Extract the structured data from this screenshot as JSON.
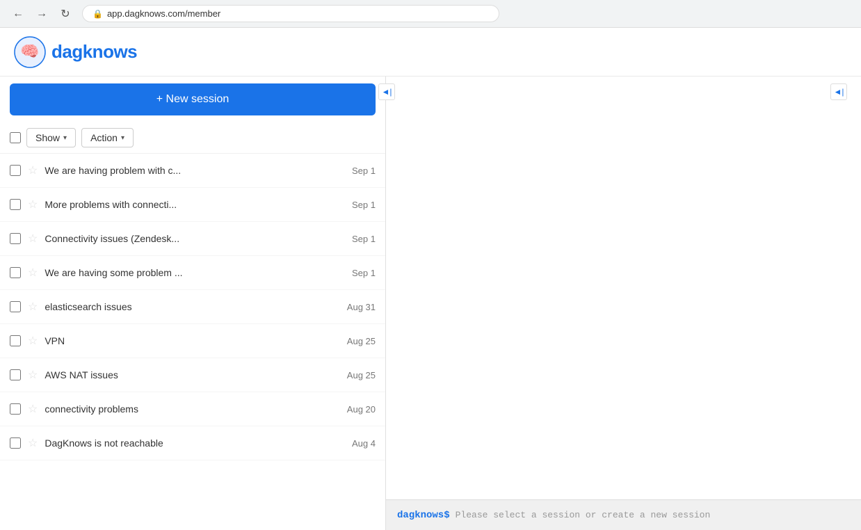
{
  "browser": {
    "url": "app.dagknows.com/member",
    "lock_icon": "🔒"
  },
  "header": {
    "logo_text": "dagknows",
    "logo_alt": "DagKnows Logo"
  },
  "left_panel": {
    "new_session_label": "+ New session",
    "show_label": "Show",
    "action_label": "Action",
    "collapse_icon": "◄|"
  },
  "right_panel": {
    "collapse_icon": "◄|"
  },
  "sessions": [
    {
      "title": "We are having problem with c...",
      "date": "Sep 1"
    },
    {
      "title": "More problems with connecti...",
      "date": "Sep 1"
    },
    {
      "title": "Connectivity issues (Zendesk...",
      "date": "Sep 1"
    },
    {
      "title": "We are having some problem ...",
      "date": "Sep 1"
    },
    {
      "title": "elasticsearch issues",
      "date": "Aug 31"
    },
    {
      "title": "VPN",
      "date": "Aug 25"
    },
    {
      "title": "AWS NAT issues",
      "date": "Aug 25"
    },
    {
      "title": "connectivity problems",
      "date": "Aug 20"
    },
    {
      "title": "DagKnows is not reachable",
      "date": "Aug 4"
    }
  ],
  "terminal": {
    "prompt": "dagknows$",
    "placeholder": "Please select a session or create a new session"
  }
}
